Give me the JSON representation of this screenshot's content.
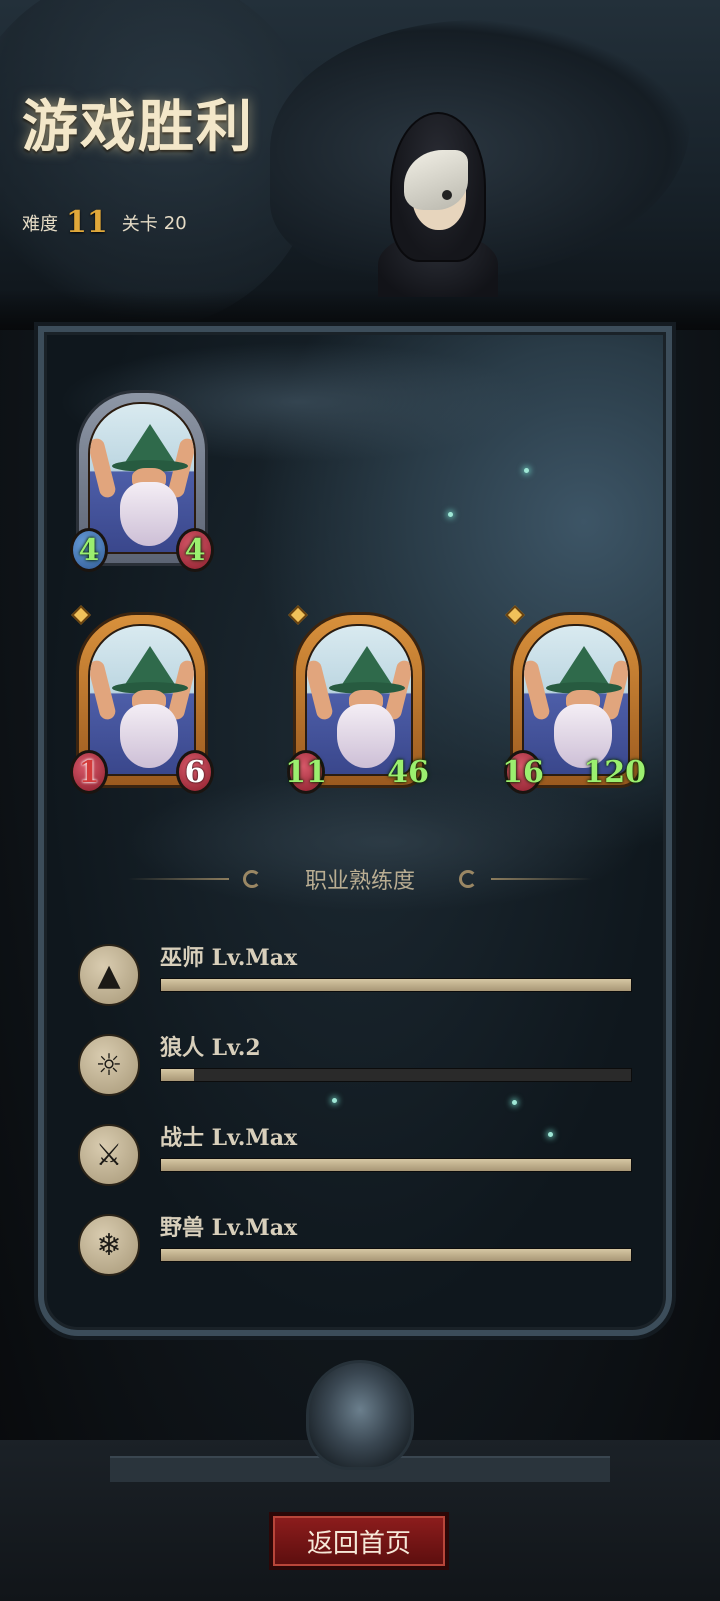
{
  "header": {
    "title": "游戏胜利",
    "difficulty_label": "难度",
    "difficulty_value": "11",
    "stage_label": "关卡",
    "stage_value": "20"
  },
  "cards": [
    {
      "name": "wizard",
      "frame": "silver",
      "attack": "4",
      "health": "4"
    },
    {
      "name": "wizard",
      "frame": "gold",
      "attack": "1",
      "health": "6"
    },
    {
      "name": "wizard",
      "frame": "gold",
      "attack": "11",
      "health": "46"
    },
    {
      "name": "wizard",
      "frame": "gold",
      "attack": "16",
      "health": "120"
    }
  ],
  "mastery": {
    "title": "职业熟练度",
    "items": [
      {
        "label": "巫师 Lv.Max",
        "progress": 1.0,
        "icon": "wizard-hat-icon"
      },
      {
        "label": "狼人 Lv.2",
        "progress": 0.07,
        "icon": "wolf-icon"
      },
      {
        "label": "战士 Lv.Max",
        "progress": 1.0,
        "icon": "sword-icon"
      },
      {
        "label": "野兽 Lv.Max",
        "progress": 1.0,
        "icon": "claw-icon"
      }
    ]
  },
  "footer": {
    "home_button": "返回首页"
  },
  "colors": {
    "accent_gold": "#e0a83a",
    "button_red": "#8e1d1d",
    "stat_green": "#9bef6f",
    "bar_fill": "#c9b994"
  }
}
